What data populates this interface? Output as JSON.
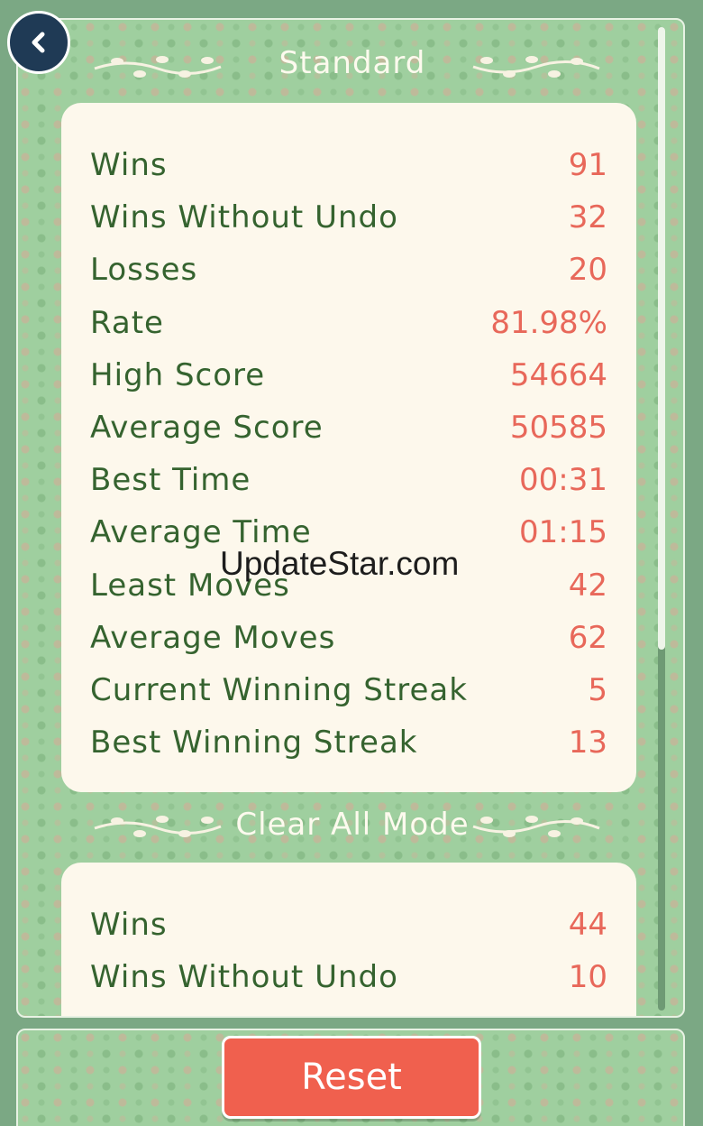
{
  "back_icon": "chevron-left-icon",
  "sections": [
    {
      "title": "Standard",
      "stats": [
        {
          "label": "Wins",
          "value": "91"
        },
        {
          "label": "Wins Without Undo",
          "value": "32"
        },
        {
          "label": "Losses",
          "value": "20"
        },
        {
          "label": "Rate",
          "value": "81.98%"
        },
        {
          "label": "High Score",
          "value": "54664"
        },
        {
          "label": "Average Score",
          "value": "50585"
        },
        {
          "label": "Best Time",
          "value": "00:31"
        },
        {
          "label": "Average Time",
          "value": "01:15"
        },
        {
          "label": "Least Moves",
          "value": "42"
        },
        {
          "label": "Average Moves",
          "value": "62"
        },
        {
          "label": "Current Winning Streak",
          "value": "5"
        },
        {
          "label": "Best Winning Streak",
          "value": "13"
        }
      ]
    },
    {
      "title": "Clear All Mode",
      "stats": [
        {
          "label": "Wins",
          "value": "44"
        },
        {
          "label": "Wins Without Undo",
          "value": "10"
        }
      ]
    }
  ],
  "reset_label": "Reset",
  "watermark": "UpdateStar.com",
  "colors": {
    "background": "#7ba884",
    "card": "#fdf8ec",
    "label": "#35632f",
    "value": "#e8685a",
    "reset": "#f0604e",
    "back": "#1f3a55"
  }
}
